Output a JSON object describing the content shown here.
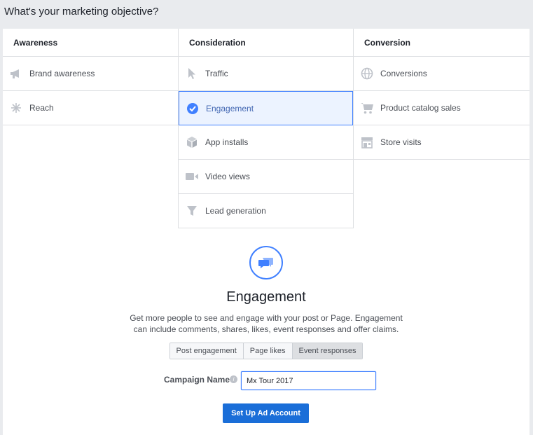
{
  "page_title": "What's your marketing objective?",
  "columns": [
    {
      "heading": "Awareness",
      "items": [
        {
          "label": "Brand awareness",
          "icon": "megaphone-icon"
        },
        {
          "label": "Reach",
          "icon": "burst-icon"
        }
      ]
    },
    {
      "heading": "Consideration",
      "items": [
        {
          "label": "Traffic",
          "icon": "cursor-icon"
        },
        {
          "label": "Engagement",
          "icon": "checkmark-icon",
          "selected": true
        },
        {
          "label": "App installs",
          "icon": "box-icon"
        },
        {
          "label": "Video views",
          "icon": "video-icon"
        },
        {
          "label": "Lead generation",
          "icon": "funnel-icon"
        }
      ]
    },
    {
      "heading": "Conversion",
      "items": [
        {
          "label": "Conversions",
          "icon": "globe-icon"
        },
        {
          "label": "Product catalog sales",
          "icon": "cart-icon"
        },
        {
          "label": "Store visits",
          "icon": "store-icon"
        }
      ]
    }
  ],
  "detail": {
    "title": "Engagement",
    "description": "Get more people to see and engage with your post or Page. Engagement can include comments, shares, likes, event responses and offer claims.",
    "icon": "chat-bubbles-icon",
    "tabs": [
      "Post engagement",
      "Page likes",
      "Event responses"
    ],
    "active_tab": "Event responses"
  },
  "campaign": {
    "label": "Campaign Name",
    "value": "Mx Tour 2017"
  },
  "setup_button": "Set Up Ad Account",
  "colors": {
    "accent": "#4080ff",
    "selected_bg": "#ecf3ff",
    "button": "#1a6ed8"
  }
}
